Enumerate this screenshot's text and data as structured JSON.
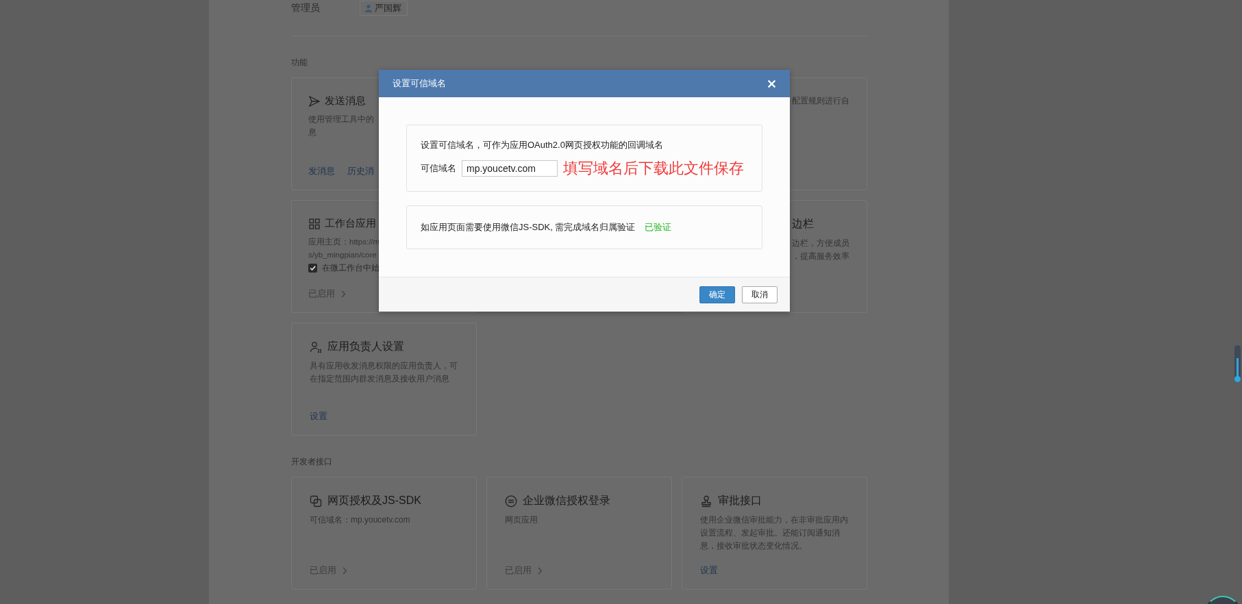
{
  "admin": {
    "label": "管理员",
    "name": "严国辉"
  },
  "sections": [
    {
      "title": "功能",
      "cards": [
        {
          "kind": "cut-right",
          "title": "发送消息",
          "lines": [
            "使用管理工具中的",
            "息"
          ],
          "links": [
            "发消息",
            "历史消"
          ]
        },
        {
          "kind": "cut-left",
          "lines": [
            "配置规则进行自"
          ]
        },
        {
          "kind": "cut-right",
          "title": "工作台应用",
          "lines": [
            "应用主页：https://m",
            "s/yb_mingpian/core"
          ],
          "checkbox": {
            "label": "在微工作台中始",
            "checked": true
          },
          "status": "已启用"
        },
        {
          "kind": "cut-left",
          "title": "边栏",
          "lines": [
            "边栏，方便成员",
            "，提高服务效率"
          ]
        },
        {
          "kind": "full",
          "title": "应用负责人设置",
          "desc": "具有应用收发消息权限的应用负责人，可在指定范围内群发消息及接收用户消息",
          "links": [
            "设置"
          ]
        }
      ]
    },
    {
      "title": "开发者接口",
      "cards": [
        {
          "kind": "full",
          "title": "网页授权及JS-SDK",
          "desc": "可信域名：mp.youcetv.com",
          "status": "已启用"
        },
        {
          "kind": "full",
          "title": "企业微信授权登录",
          "desc": "网页应用",
          "status": "已启用"
        },
        {
          "kind": "full",
          "title": "审批接口",
          "desc": "使用企业微信审批能力，在非审批应用内设置流程、发起审批。还能订阅通知消息，接收审批状态变化情况。",
          "links": [
            "设置"
          ]
        }
      ]
    }
  ],
  "modal": {
    "title": "设置可信域名",
    "intro": "设置可信域名，可作为应用OAuth2.0网页授权功能的回调域名",
    "field_label": "可信域名",
    "field_value": "mp.youcetv.com",
    "annotation": "填写域名后下载此文件保存",
    "verify_text": "如应用页面需要使用微信JS-SDK, 需完成域名归属验证",
    "verify_status": "已验证",
    "buttons": [
      {
        "label": "确定",
        "kind": "primary"
      },
      {
        "label": "取消",
        "kind": "default"
      }
    ]
  }
}
